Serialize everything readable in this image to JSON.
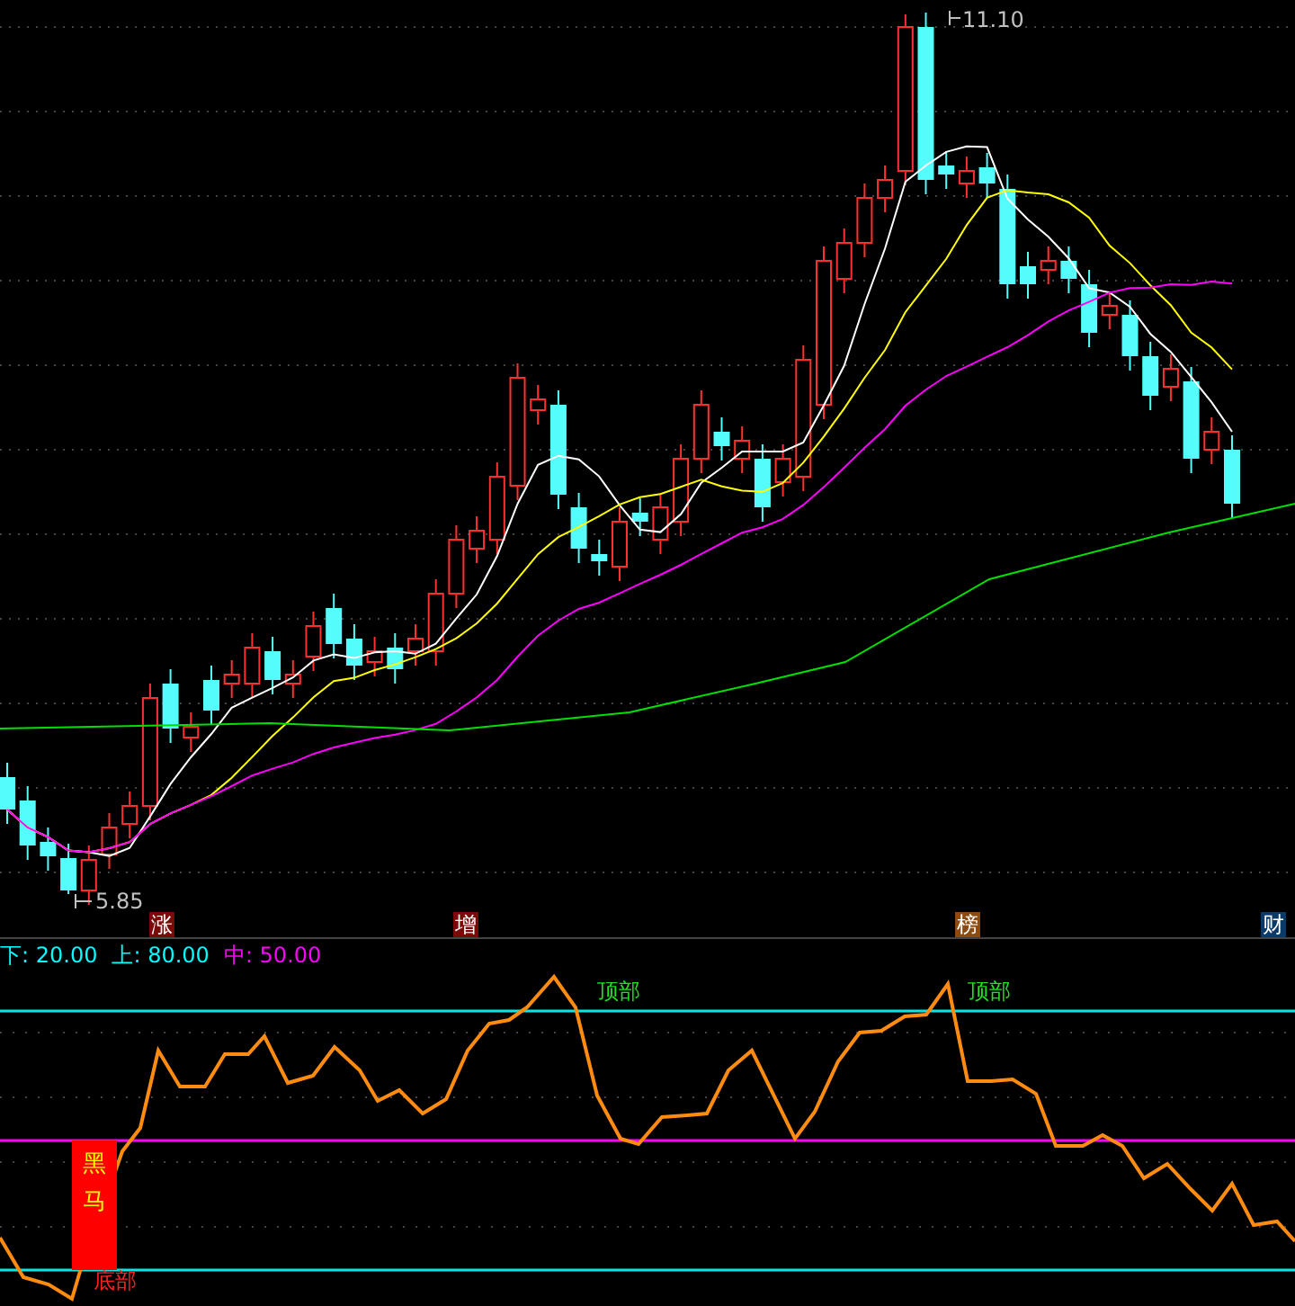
{
  "price_chart": {
    "high_label": "11.10",
    "low_label": "5.85",
    "markers": [
      {
        "text": "涨",
        "color": "#7a0a0a"
      },
      {
        "text": "增",
        "color": "#7a0a0a"
      },
      {
        "text": "榜",
        "color": "#8a4a10"
      },
      {
        "text": "财",
        "color": "#0a3a6a"
      }
    ]
  },
  "indicator": {
    "legend": [
      {
        "text": "下: 20.00",
        "color": "#00ffff"
      },
      {
        "text": "上: 80.00",
        "color": "#00ffff"
      },
      {
        "text": "中: 50.00",
        "color": "#ff00ff"
      }
    ],
    "signals": [
      {
        "kind": "horse",
        "text": "黑马"
      },
      {
        "kind": "bottom",
        "text": "底部"
      },
      {
        "kind": "top",
        "text": "顶部"
      },
      {
        "kind": "top",
        "text": "顶部"
      }
    ]
  }
}
